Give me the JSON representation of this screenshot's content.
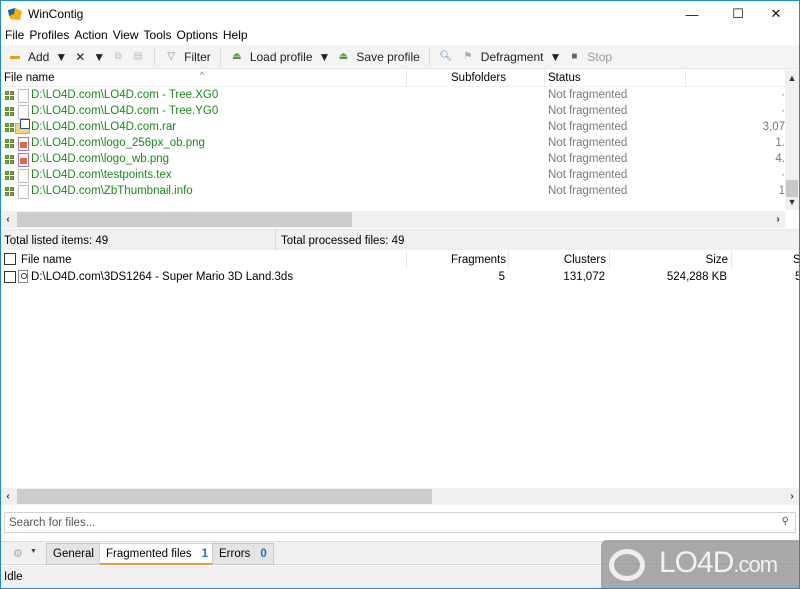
{
  "window": {
    "title": "WinContig",
    "controls": {
      "minimize": "—",
      "maximize": "☐",
      "close": "✕"
    }
  },
  "menu": [
    "File",
    "Profiles",
    "Action",
    "View",
    "Tools",
    "Options",
    "Help"
  ],
  "toolbar": {
    "add": "Add",
    "filter": "Filter",
    "load_profile": "Load profile",
    "save_profile": "Save profile",
    "defragment": "Defragment",
    "stop": "Stop"
  },
  "top_list": {
    "columns": {
      "file_name": "File name",
      "subfolders": "Subfolders",
      "status": "Status"
    },
    "rows": [
      {
        "icon": "blank-file",
        "name": "D:\\LO4D.com\\LO4D.com - Tree.XG0",
        "status": "Not fragmented",
        "size": "·"
      },
      {
        "icon": "blank-file",
        "name": "D:\\LO4D.com\\LO4D.com - Tree.YG0",
        "status": "Not fragmented",
        "size": "·"
      },
      {
        "icon": "archive-folder",
        "name": "D:\\LO4D.com\\LO4D.com.rar",
        "status": "Not fragmented",
        "size": "3,07"
      },
      {
        "icon": "image-file",
        "name": "D:\\LO4D.com\\logo_256px_ob.png",
        "status": "Not fragmented",
        "size": "1."
      },
      {
        "icon": "image-file",
        "name": "D:\\LO4D.com\\logo_wb.png",
        "status": "Not fragmented",
        "size": "4."
      },
      {
        "icon": "blank-file",
        "name": "D:\\LO4D.com\\testpoints.tex",
        "status": "Not fragmented",
        "size": "·"
      },
      {
        "icon": "blank-file",
        "name": "D:\\LO4D.com\\ZbThumbnail.info",
        "status": "Not fragmented",
        "size": "1"
      }
    ]
  },
  "totals": {
    "listed": "Total listed items: 49",
    "processed": "Total processed files: 49"
  },
  "fragmented_list": {
    "columns": {
      "file_name": "File name",
      "fragments": "Fragments",
      "clusters": "Clusters",
      "size": "Size",
      "extra": "Si"
    },
    "rows": [
      {
        "name": "D:\\LO4D.com\\3DS1264 - Super Mario 3D Land.3ds",
        "fragments": "5",
        "clusters": "131,072",
        "size": "524,288 KB",
        "extra": "5"
      }
    ]
  },
  "search": {
    "placeholder": "Search for files..."
  },
  "tabs": [
    {
      "label": "General"
    },
    {
      "label": "Fragmented files",
      "count": "1"
    },
    {
      "label": "Errors",
      "count": "0"
    }
  ],
  "status": "Idle",
  "watermark": {
    "text": "LO4D",
    "suffix": ".com"
  },
  "colors": {
    "accent": "#1e88d6",
    "file_text": "#1a8a1a",
    "badge": "#1b6cc9",
    "active_tab": "#e2a23a"
  }
}
